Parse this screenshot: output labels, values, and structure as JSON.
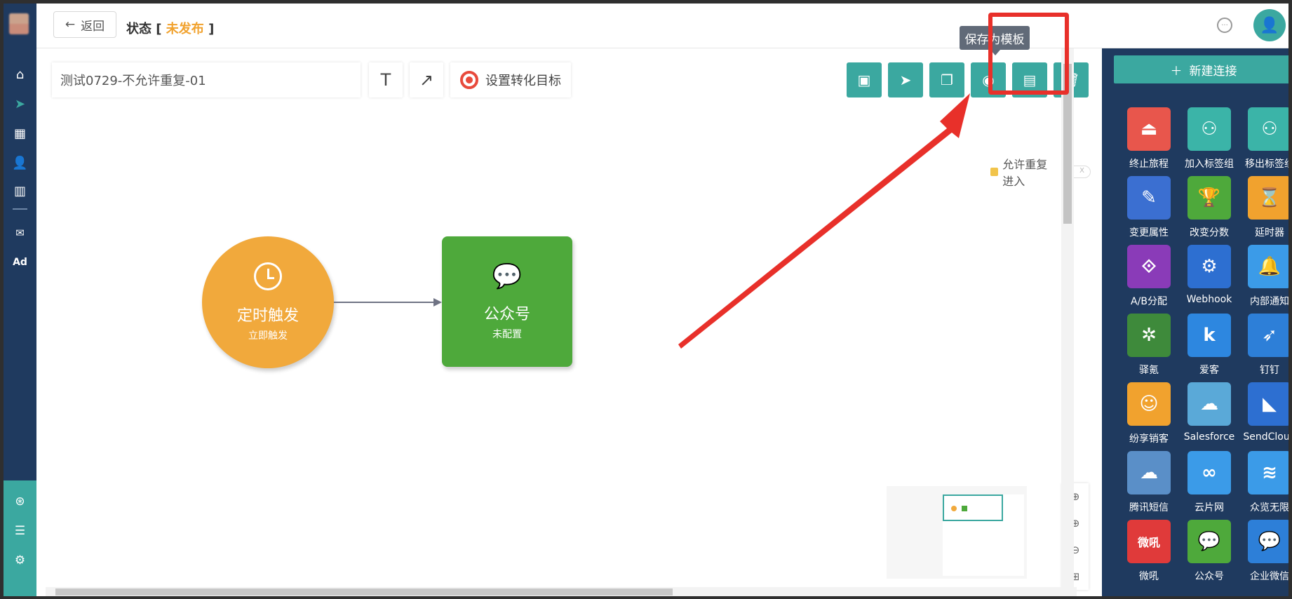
{
  "header": {
    "back_label": "返回",
    "back_icon": "arrow-left-icon",
    "status_prefix": "状态 [",
    "status_value": "未发布",
    "status_suffix": "]"
  },
  "toolbar": {
    "journey_name": "测试0729-不允许重复-01",
    "text_tool_icon": "T",
    "arrow_tool_icon": "↗",
    "goal_label": "设置转化目标",
    "tooltip": "保存为模板",
    "repeat_label": "允许重复进入",
    "toggle_text": "X"
  },
  "nodes": {
    "timer": {
      "title": "定时触发",
      "sub": "立即触发"
    },
    "wechat": {
      "title": "公众号",
      "sub": "未配置"
    }
  },
  "panel": {
    "new_connection": "新建连接",
    "components": [
      {
        "label": "终止旅程",
        "color": "#e8564c",
        "glyph": "⏏"
      },
      {
        "label": "加入标签组",
        "color": "#3bb4a8",
        "glyph": "⚇"
      },
      {
        "label": "移出标签组",
        "color": "#3bb4a8",
        "glyph": "⚇"
      },
      {
        "label": "变更属性",
        "color": "#3b6fd1",
        "glyph": "✎"
      },
      {
        "label": "改变分数",
        "color": "#4ea93b",
        "glyph": "🏆"
      },
      {
        "label": "延时器",
        "color": "#f1a22e",
        "glyph": "⌛"
      },
      {
        "label": "A/B分配",
        "color": "#8a3bb8",
        "glyph": "⟐"
      },
      {
        "label": "Webhook",
        "color": "#2d6fd1",
        "glyph": "⚙"
      },
      {
        "label": "内部通知",
        "color": "#3b9be8",
        "glyph": "🔔"
      },
      {
        "label": "驿氪",
        "color": "#3e8a3b",
        "glyph": "✲"
      },
      {
        "label": "爱客",
        "color": "#2d87e0",
        "glyph": "k"
      },
      {
        "label": "钉钉",
        "color": "#2d7fd8",
        "glyph": "➶"
      },
      {
        "label": "纷享销客",
        "color": "#f1a22e",
        "glyph": "☺"
      },
      {
        "label": "Salesforce",
        "color": "#5aa9d8",
        "glyph": "☁"
      },
      {
        "label": "SendCloud",
        "color": "#2d6fd1",
        "glyph": "◣"
      },
      {
        "label": "腾讯短信",
        "color": "#5a8fc8",
        "glyph": "☁"
      },
      {
        "label": "云片网",
        "color": "#3b9be8",
        "glyph": "∞"
      },
      {
        "label": "众览无限",
        "color": "#3b9be8",
        "glyph": "≋"
      },
      {
        "label": "微吼",
        "color": "#e03a3a",
        "glyph": "微吼"
      },
      {
        "label": "公众号",
        "color": "#4ea93b",
        "glyph": "💬"
      },
      {
        "label": "企业微信",
        "color": "#2d7fd8",
        "glyph": "💬"
      }
    ]
  },
  "colors": {
    "accent": "#3ba8a0",
    "nav": "#1f3a5f",
    "status": "#f1a22e",
    "annotation": "#e8302a"
  }
}
